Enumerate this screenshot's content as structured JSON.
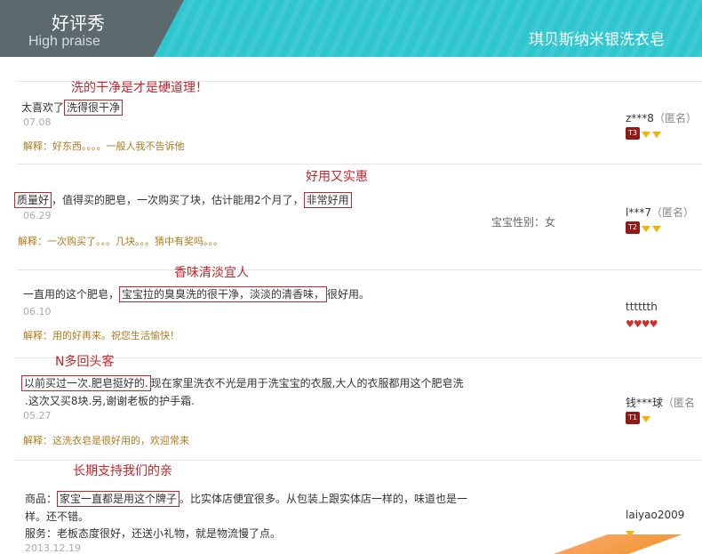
{
  "header": {
    "title_cn": "好评秀",
    "title_en": "High praise",
    "product": "琪贝斯纳米银洗衣皂"
  },
  "reviews": [
    {
      "tag": "洗的干净是才是硬道理！",
      "line1_pre": "太喜欢了",
      "line1_box": "洗得很干净",
      "date": "07.08",
      "reply": "解释：好东西。。。。一般人我不告诉他",
      "user": "z***8",
      "anon": "（匿名）",
      "level": "T3",
      "gems": 2
    },
    {
      "tag": "好用又实惠",
      "line1_box1": "质量好",
      "line1_mid": "，值得买的肥皂，一次购买了块，估计能用2个月了，",
      "line1_box2": "非常好用",
      "date": "06.29",
      "reply": "解释：一次购买了。。。几块。。。猜中有奖吗。。。",
      "extra": "宝宝性别：女",
      "user": "l***7",
      "anon": "（匿名）",
      "level": "T2",
      "gems": 2
    },
    {
      "tag": "香味清淡宜人",
      "line1_pre": "一直用的这个肥皂，",
      "line1_box": "宝宝拉的臭臭洗的很干净，淡淡的清香味，",
      "line1_post": "很好用。",
      "date": "06.10",
      "reply": "解释：用的好再来。祝您生活愉快！",
      "user": "tttttth",
      "hearts": "♥♥♥♥"
    },
    {
      "tag": "N多回头客",
      "line1_box": "以前买过一次.肥皂挺好的.",
      "line1_post": "现在家里洗衣不光是用于洗宝宝的衣服,大人的衣服都用这个肥皂洗",
      "line2": ".这次又买8块.另,谢谢老板的护手霜.",
      "date": "05.27",
      "reply": "解释：这洗衣皂是很好用的，欢迎常来",
      "user": "钱***球",
      "anon": "（匿名",
      "level": "T1",
      "gems": 1
    },
    {
      "tag": "长期支持我们的亲",
      "line1_pre": "商品：",
      "line1_box": "家宝一直都是用这个牌子",
      "line1_post": "。比实体店便宜很多。从包装上跟实体店一样的，味道也是一",
      "line2": "样。还不错。",
      "line3": "服务：老板态度很好，还送小礼物，就是物流慢了点。",
      "date": "2013.12.19",
      "user": "laiyao2009",
      "gems": 1
    }
  ],
  "colors": {
    "banner": "#2ec6cf",
    "accent": "#c0272d",
    "reply": "#b07a1e"
  }
}
